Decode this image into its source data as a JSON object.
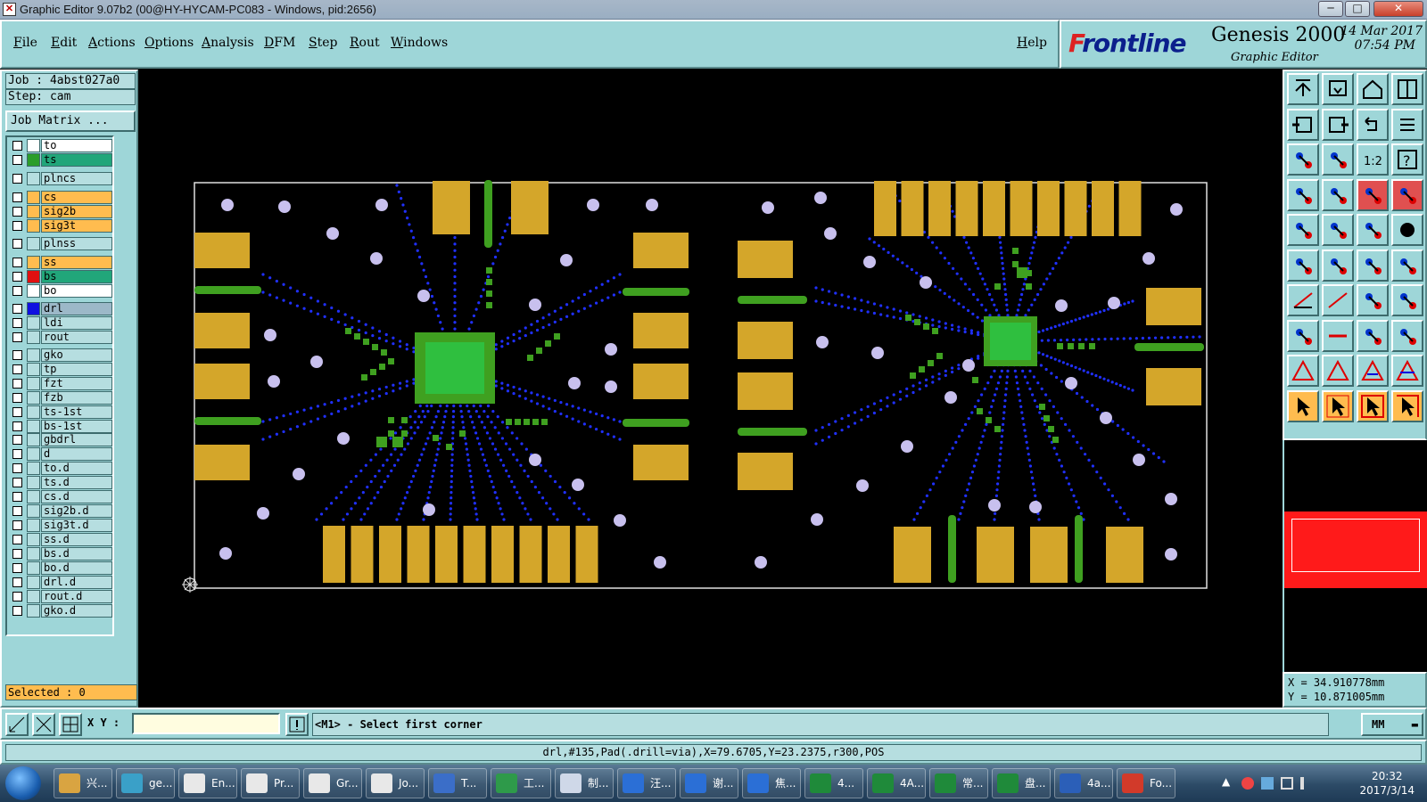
{
  "window": {
    "title": "Graphic Editor 9.07b2 (00@HY-HYCAM-PC083 - Windows, pid:2656)",
    "minimize": "─",
    "maximize": "□",
    "close": "✕"
  },
  "menu": {
    "items": [
      "File",
      "Edit",
      "Actions",
      "Options",
      "Analysis",
      "DFM",
      "Step",
      "Rout",
      "Windows"
    ],
    "help": "Help"
  },
  "brand": {
    "logo_prefix": "F",
    "logo_rest": "rontline",
    "product": "Genesis 2000",
    "subtitle": "Graphic Editor",
    "date": "14 Mar 2017",
    "time": "07:54 PM"
  },
  "job": {
    "job_label": "Job : 4abst027a0",
    "step_label": "Step: cam",
    "matrix_button": "Job Matrix ..."
  },
  "layers": [
    {
      "name": "to",
      "color": "#ffffff",
      "swatch": "#ffffff"
    },
    {
      "name": "ts",
      "color": "#21a67a",
      "swatch": "#2a9d2a"
    },
    {
      "name": "plncs",
      "color": "#b6dee0",
      "swatch": "#b6dee0"
    },
    {
      "name": "cs",
      "color": "#ffbc4f",
      "swatch": "#ffbc4f"
    },
    {
      "name": "sig2b",
      "color": "#ffbc4f",
      "swatch": "#ffbc4f"
    },
    {
      "name": "sig3t",
      "color": "#ffbc4f",
      "swatch": "#ffbc4f"
    },
    {
      "name": "plnss",
      "color": "#b6dee0",
      "swatch": "#b6dee0"
    },
    {
      "name": "ss",
      "color": "#ffbc4f",
      "swatch": "#ffbc4f"
    },
    {
      "name": "bs",
      "color": "#21a67a",
      "swatch": "#e01010"
    },
    {
      "name": "bo",
      "color": "#ffffff",
      "swatch": "#ffffff"
    },
    {
      "name": "drl",
      "color": "#9cb8c8",
      "swatch": "#1010e0"
    },
    {
      "name": "ldi",
      "color": "#b6dee0",
      "swatch": "#b6dee0"
    },
    {
      "name": "rout",
      "color": "#b6dee0",
      "swatch": "#b6dee0"
    },
    {
      "name": "gko",
      "color": "#b6dee0",
      "swatch": "#b6dee0"
    },
    {
      "name": "tp",
      "color": "#b6dee0",
      "swatch": "#b6dee0"
    },
    {
      "name": "fzt",
      "color": "#b6dee0",
      "swatch": "#b6dee0"
    },
    {
      "name": "fzb",
      "color": "#b6dee0",
      "swatch": "#b6dee0"
    },
    {
      "name": "ts-1st",
      "color": "#b6dee0",
      "swatch": "#b6dee0"
    },
    {
      "name": "bs-1st",
      "color": "#b6dee0",
      "swatch": "#b6dee0"
    },
    {
      "name": "gbdrl",
      "color": "#b6dee0",
      "swatch": "#b6dee0"
    },
    {
      "name": "d",
      "color": "#b6dee0",
      "swatch": "#b6dee0"
    },
    {
      "name": "to.d",
      "color": "#b6dee0",
      "swatch": "#b6dee0"
    },
    {
      "name": "ts.d",
      "color": "#b6dee0",
      "swatch": "#b6dee0"
    },
    {
      "name": "cs.d",
      "color": "#b6dee0",
      "swatch": "#b6dee0"
    },
    {
      "name": "sig2b.d",
      "color": "#b6dee0",
      "swatch": "#b6dee0"
    },
    {
      "name": "sig3t.d",
      "color": "#b6dee0",
      "swatch": "#b6dee0"
    },
    {
      "name": "ss.d",
      "color": "#b6dee0",
      "swatch": "#b6dee0"
    },
    {
      "name": "bs.d",
      "color": "#b6dee0",
      "swatch": "#b6dee0"
    },
    {
      "name": "bo.d",
      "color": "#b6dee0",
      "swatch": "#b6dee0"
    },
    {
      "name": "drl.d",
      "color": "#b6dee0",
      "swatch": "#b6dee0"
    },
    {
      "name": "rout.d",
      "color": "#b6dee0",
      "swatch": "#b6dee0"
    },
    {
      "name": "gko.d",
      "color": "#b6dee0",
      "swatch": "#b6dee0"
    }
  ],
  "selected": "Selected : 0",
  "coords": {
    "x": "X = 34.910778mm",
    "y": "Y = 10.871005mm"
  },
  "command": {
    "xy_label": "X Y :",
    "xy_value": "",
    "prompt": "<M1> - Select first corner",
    "units": "MM"
  },
  "status": "drl,#135,Pad(.drill=via),X=79.6705,Y=23.2375,r300,POS",
  "taskbar": {
    "tasks": [
      {
        "label": "兴...",
        "color": "#d9a441"
      },
      {
        "label": "ge...",
        "color": "#3aa0c8"
      },
      {
        "label": "En...",
        "color": "#e8e8e8"
      },
      {
        "label": "Pr...",
        "color": "#e8e8e8"
      },
      {
        "label": "Gr...",
        "color": "#e8e8e8"
      },
      {
        "label": "Jo...",
        "color": "#e8e8e8"
      },
      {
        "label": "T...",
        "color": "#3b6ec8"
      },
      {
        "label": "工...",
        "color": "#2e9a4a"
      },
      {
        "label": "制...",
        "color": "#cfd8e8"
      },
      {
        "label": "汪...",
        "color": "#2b6fd6"
      },
      {
        "label": "谢...",
        "color": "#2b6fd6"
      },
      {
        "label": "焦...",
        "color": "#2b6fd6"
      },
      {
        "label": "4...",
        "color": "#1f8a3a"
      },
      {
        "label": "4A...",
        "color": "#1f8a3a"
      },
      {
        "label": "常...",
        "color": "#1f8a3a"
      },
      {
        "label": "盘...",
        "color": "#1f8a3a"
      },
      {
        "label": "4a...",
        "color": "#2b5fb8"
      },
      {
        "label": "Fo...",
        "color": "#d23a2a"
      }
    ],
    "time": "20:32",
    "date": "2017/3/14"
  }
}
